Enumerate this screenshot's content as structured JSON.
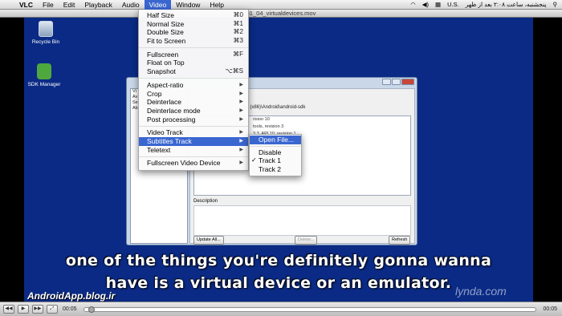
{
  "menubar": {
    "app": "VLC",
    "items": [
      "File",
      "Edit",
      "Playback",
      "Audio",
      "Video",
      "Window",
      "Help"
    ],
    "active": "Video",
    "status_locale": "U.S.",
    "status_datetime": "پنجشنبه، ساعت ۲:۰۸ بعد از ظهر"
  },
  "window": {
    "title": "01_04_virtualdevices.mov"
  },
  "desktop": {
    "icons": [
      {
        "label": "Recycle Bin"
      },
      {
        "label": "SDK Manager"
      }
    ]
  },
  "sdk_window": {
    "left_items": [
      "Vi",
      "Av",
      "Se",
      "Ab"
    ],
    "path": "tiles (x86)\\Android\\android-sdk",
    "list_items": [
      "rision 10",
      "tools, revision 3",
      "3.3, API 10, revision 1"
    ],
    "description_label": "Description",
    "buttons": {
      "update_all": "Update All...",
      "delete": "Delete...",
      "refresh": "Refresh"
    }
  },
  "video_menu": {
    "items": [
      {
        "label": "Half Size",
        "shortcut": "⌘0"
      },
      {
        "label": "Normal Size",
        "shortcut": "⌘1"
      },
      {
        "label": "Double Size",
        "shortcut": "⌘2"
      },
      {
        "label": "Fit to Screen",
        "shortcut": "⌘3"
      },
      {
        "sep": true
      },
      {
        "label": "Fullscreen",
        "shortcut": "⌘F"
      },
      {
        "label": "Float on Top",
        "shortcut": ""
      },
      {
        "label": "Snapshot",
        "shortcut": "⌥⌘S"
      },
      {
        "sep": true
      },
      {
        "label": "Aspect-ratio",
        "submenu": true
      },
      {
        "label": "Crop",
        "submenu": true
      },
      {
        "label": "Deinterlace",
        "submenu": true
      },
      {
        "label": "Deinterlace mode",
        "submenu": true
      },
      {
        "label": "Post processing",
        "submenu": true
      },
      {
        "sep": true
      },
      {
        "label": "Video Track",
        "submenu": true
      },
      {
        "label": "Subtitles Track",
        "submenu": true,
        "highlighted": true
      },
      {
        "label": "Teletext",
        "submenu": true
      },
      {
        "sep": true
      },
      {
        "label": "Fullscreen Video Device",
        "submenu": true
      }
    ]
  },
  "subtitles_submenu": {
    "items": [
      {
        "label": "Open File...",
        "highlighted": true
      },
      {
        "sep": true
      },
      {
        "label": "Disable"
      },
      {
        "label": "Track 1",
        "checked": true
      },
      {
        "label": "Track 2"
      }
    ]
  },
  "subtitle": {
    "line1": "one of the things you're definitely gonna wanna",
    "line2": "have is a virtual device or an emulator."
  },
  "watermark": "lynda.com",
  "blog": "AndroidApp.blog.ir",
  "controls": {
    "time_elapsed": "00:05",
    "time_remaining": "00:05",
    "position_fraction": 0.01
  },
  "colors": {
    "highlight": "#3a66d0",
    "video_bg": "#0a2a85"
  }
}
